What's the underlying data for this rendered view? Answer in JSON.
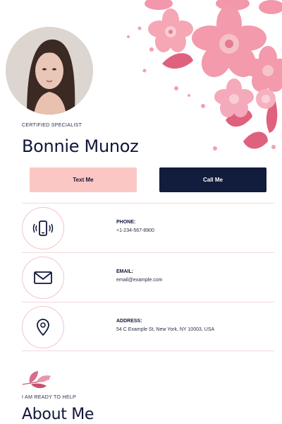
{
  "profile": {
    "title": "CERTIFIED SPECIALIST",
    "name": "Bonnie Munoz"
  },
  "actions": {
    "text_label": "Text Me",
    "call_label": "Call Me"
  },
  "contacts": [
    {
      "label": "PHONE:",
      "value": "+1-234-567-8900",
      "icon": "phone-vibrate-icon"
    },
    {
      "label": "EMAIL:",
      "value": "email@example.com",
      "icon": "envelope-icon"
    },
    {
      "label": "ADDRESS:",
      "value": "54 C Example St, New York, NY 10003, USA",
      "icon": "map-pin-icon"
    }
  ],
  "about": {
    "kicker": "I AM READY TO HELP",
    "title": "About Me"
  },
  "colors": {
    "accent_pink": "#fbc7c4",
    "navy": "#121c3d",
    "flower_pink": "#f08fa4"
  }
}
